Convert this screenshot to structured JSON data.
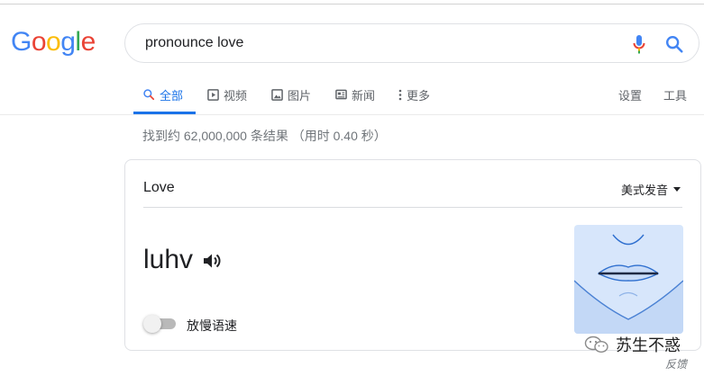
{
  "logo": {
    "letters": [
      "G",
      "o",
      "o",
      "g",
      "l",
      "e"
    ]
  },
  "search": {
    "value": "pronounce love"
  },
  "tabs": [
    {
      "label": "全部",
      "icon": "search-icon",
      "active": true
    },
    {
      "label": "视频",
      "icon": "video-icon",
      "active": false
    },
    {
      "label": "图片",
      "icon": "image-icon",
      "active": false
    },
    {
      "label": "新闻",
      "icon": "news-icon",
      "active": false
    },
    {
      "label": "更多",
      "icon": "more-vert-icon",
      "active": false
    }
  ],
  "tools": {
    "settings": "设置",
    "tools": "工具"
  },
  "result_stats": "找到约 62,000,000 条结果 （用时 0.40 秒）",
  "card": {
    "word": "Love",
    "accent": "美式发音",
    "phonetic": "luhv",
    "slow_toggle_label": "放慢语速",
    "slow_toggle_on": false
  },
  "watermark": {
    "name": "苏生不惑",
    "feedback": "反馈"
  },
  "colors": {
    "accent_blue": "#1a73e8",
    "logo_blue": "#4285f4",
    "logo_red": "#ea4335",
    "logo_yellow": "#fbbc05",
    "logo_green": "#34a853"
  }
}
